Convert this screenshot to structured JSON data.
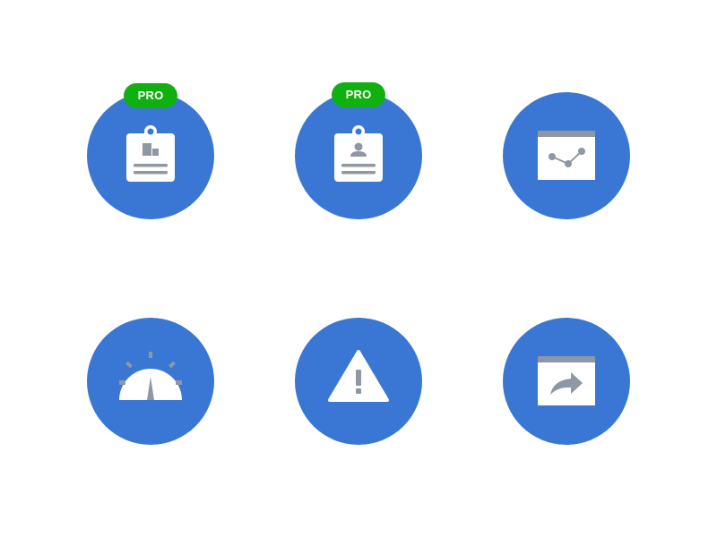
{
  "colors": {
    "tile_background": "#3a77d4",
    "badge_background": "#10b010",
    "badge_text": "#ffffff",
    "glyph_fill": "#ffffff",
    "glyph_detail": "#8e97a3"
  },
  "tiles": [
    {
      "icon": "badge-dashboard-icon",
      "badge": "PRO"
    },
    {
      "icon": "badge-user-icon",
      "badge": "PRO"
    },
    {
      "icon": "line-chart-window-icon",
      "badge": ""
    },
    {
      "icon": "speedometer-icon",
      "badge": ""
    },
    {
      "icon": "warning-icon",
      "badge": ""
    },
    {
      "icon": "share-window-icon",
      "badge": ""
    }
  ]
}
